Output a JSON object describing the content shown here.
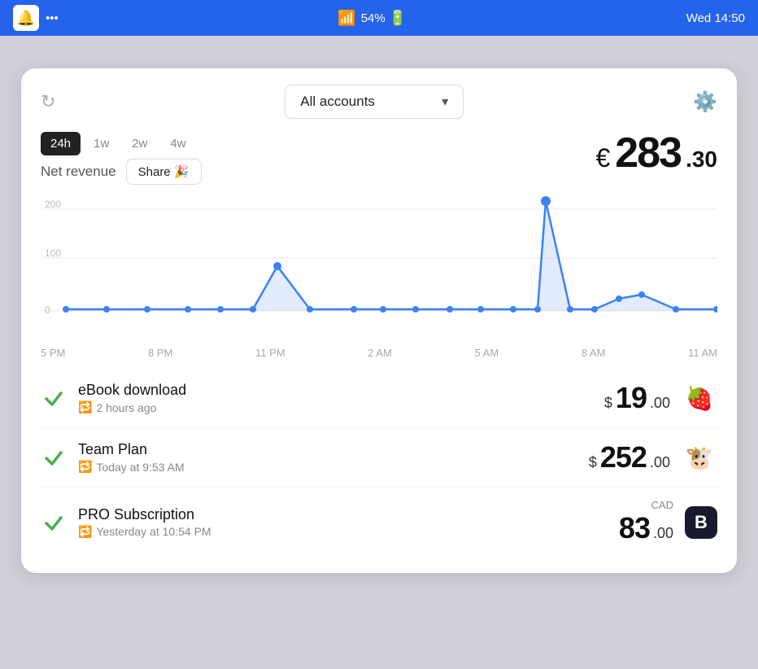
{
  "statusBar": {
    "time": "Wed 14:50",
    "battery": "54%",
    "dots": "•••"
  },
  "header": {
    "accountSelector": "All accounts",
    "chevron": "▾"
  },
  "timeFilters": [
    {
      "label": "24h",
      "active": true
    },
    {
      "label": "1w",
      "active": false
    },
    {
      "label": "2w",
      "active": false
    },
    {
      "label": "4w",
      "active": false
    }
  ],
  "netRevenue": {
    "label": "Net revenue",
    "shareLabel": "Share 🎉",
    "currencySymbol": "€",
    "amount": "283",
    "cents": ".30"
  },
  "chart": {
    "yLabels": [
      "200",
      "100",
      "0"
    ],
    "xLabels": [
      "5 PM",
      "8 PM",
      "11 PM",
      "2 AM",
      "5 AM",
      "8 AM",
      "11 AM"
    ]
  },
  "transactions": [
    {
      "name": "eBook download",
      "time": "2 hours ago",
      "currencySymbol": "$",
      "amount": "19",
      "cents": ".00",
      "icon": "🍓",
      "currencyCode": null
    },
    {
      "name": "Team Plan",
      "time": "Today at 9:53 AM",
      "currencySymbol": "$",
      "amount": "252",
      "cents": ".00",
      "icon": "🐮",
      "currencyCode": null
    },
    {
      "name": "PRO Subscription",
      "time": "Yesterday at 10:54 PM",
      "currencySymbol": null,
      "amount": "83",
      "cents": ".00",
      "icon": "B",
      "currencyCode": "CAD"
    }
  ]
}
